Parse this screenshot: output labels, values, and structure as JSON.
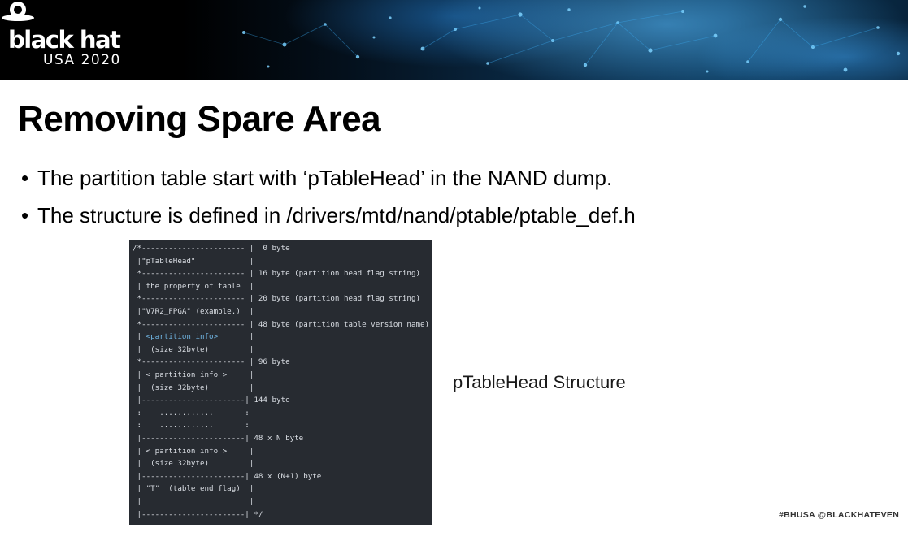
{
  "banner": {
    "logo_word": "black hat",
    "logo_sub": "USA 2020",
    "colors": {
      "background": "#000000",
      "glow": "#5abeff"
    }
  },
  "slide": {
    "title": "Removing Spare Area",
    "bullets": [
      "The partition table start with ‘pTableHead’ in the NAND dump.",
      "The structure is defined in /drivers/mtd/nand/ptable/ptable_def.h"
    ],
    "caption": "pTableHead Structure",
    "footer": "#BHUSA   @BLACKHATEVEN"
  },
  "code_lines": [
    "/*----------------------- |  0 byte",
    " |\"pTableHead\"            |",
    " *----------------------- | 16 byte (partition head flag string)",
    " | the property of table  |",
    " *----------------------- | 20 byte (partition head flag string)",
    " |\"V7R2_FPGA\" (example.)  |",
    " *----------------------- | 48 byte (partition table version name)",
    " | <partition info>       |",
    " |  (size 32byte)         |",
    " *----------------------- | 96 byte",
    " | < partition info >     |",
    " |  (size 32byte)         |",
    " |-----------------------| 144 byte",
    " :    ............       :",
    " :    ............       :",
    " |-----------------------| 48 x N byte",
    " | < partition info >     |",
    " |  (size 32byte)         |",
    " |-----------------------| 48 x (N+1) byte",
    " | \"T\"  (table end flag)  |",
    " |                        |",
    " |-----------------------| */"
  ],
  "code_highlight": {
    "color": "#6fb3e0"
  },
  "code_background": "#272b31"
}
